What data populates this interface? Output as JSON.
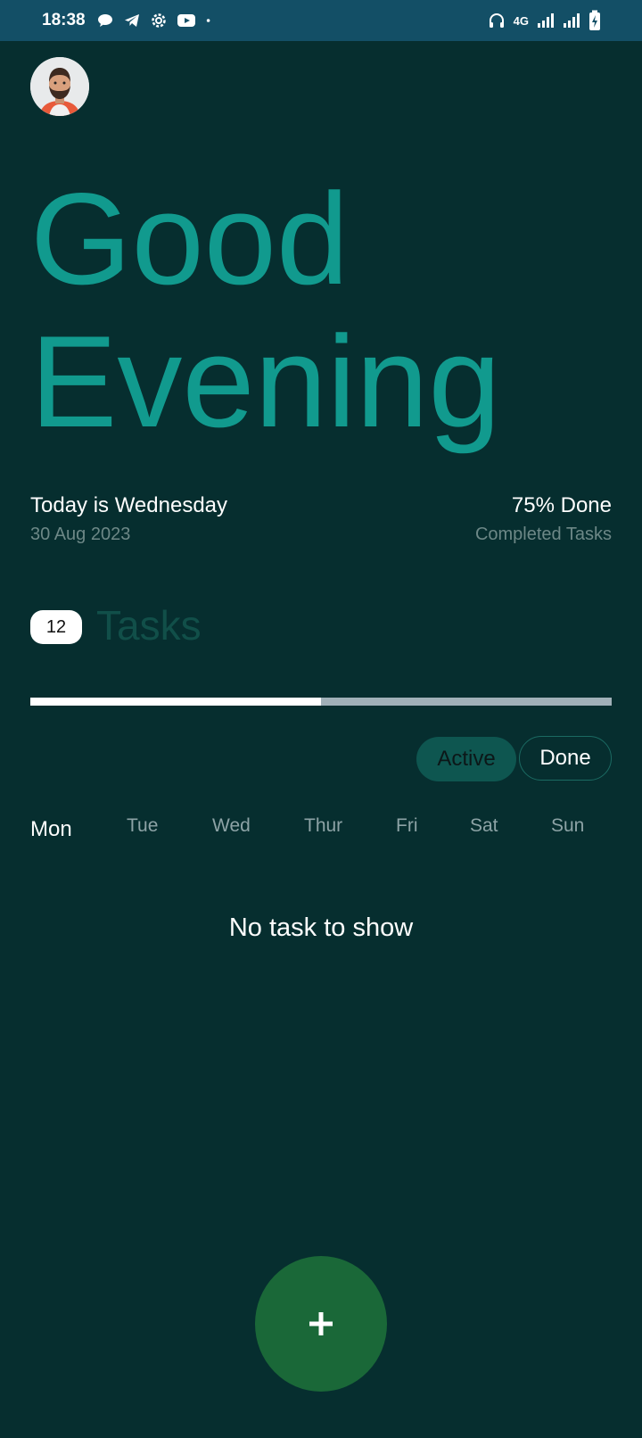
{
  "status_bar": {
    "time": "18:38",
    "network": "4G",
    "left_icons": [
      "chat-bubble-icon",
      "telegram-icon",
      "settings-gear-icon",
      "youtube-icon",
      "dot-icon"
    ],
    "right_icons": [
      "headphones-icon",
      "signal-icon",
      "signal-icon",
      "battery-charging-icon"
    ]
  },
  "header": {
    "greeting_line1": "Good",
    "greeting_line2": "Evening"
  },
  "summary": {
    "today_label": "Today is Wednesday",
    "date": "30 Aug 2023",
    "done_label": "75% Done",
    "done_sub": "Completed Tasks"
  },
  "tasks": {
    "count": "12",
    "label": "Tasks",
    "progress_fraction": 0.5
  },
  "filters": {
    "active": "Active",
    "done": "Done",
    "selected": "Active"
  },
  "days": {
    "items": [
      "Mon",
      "Tue",
      "Wed",
      "Thur",
      "Fri",
      "Sat",
      "Sun"
    ],
    "selected": "Mon"
  },
  "empty_state": "No task to show",
  "fab_icon": "plus-icon",
  "colors": {
    "background": "#062e2f",
    "accent": "#119a8e",
    "fab": "#1a6838",
    "status_bar": "#134f66"
  }
}
